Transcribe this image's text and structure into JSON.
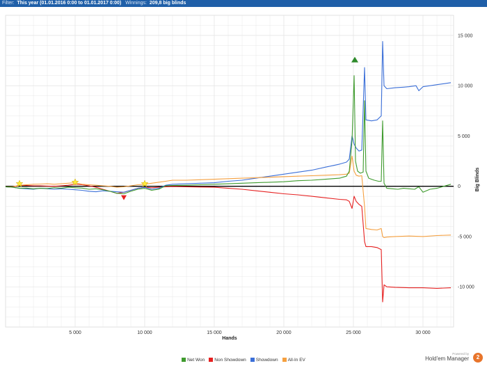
{
  "filter_bar": {
    "filter_label": "Filter:",
    "filter_value": "This year (01.01.2016 0:00 to 01.01.2017 0:00)",
    "winnings_label": "Winnings:",
    "winnings_value": "209,8 big blinds"
  },
  "branding": {
    "powered_by": "Powered by",
    "product": "Hold'em Manager",
    "logo_glyph": "2"
  },
  "colors": {
    "net_won": "#3f9b2e",
    "non_showdown": "#e62020",
    "showdown": "#3b6fd8",
    "all_in_ev": "#f5a040",
    "zero_line": "#000000",
    "grid": "#e2e2e2"
  },
  "chart_data": {
    "type": "line",
    "title": "",
    "xlabel": "Hands",
    "ylabel": "Big Blinds",
    "xlim": [
      0,
      32200
    ],
    "ylim": [
      -14000,
      17000
    ],
    "x_ticks": [
      {
        "value": 5000,
        "label": "5 000"
      },
      {
        "value": 10000,
        "label": "10 000"
      },
      {
        "value": 15000,
        "label": "15 000"
      },
      {
        "value": 20000,
        "label": "20 000"
      },
      {
        "value": 25000,
        "label": "25 000"
      },
      {
        "value": 30000,
        "label": "30 000"
      }
    ],
    "y_ticks": [
      {
        "value": 15000,
        "label": "15 000"
      },
      {
        "value": 10000,
        "label": "10 000"
      },
      {
        "value": 5000,
        "label": "5 000"
      },
      {
        "value": 0,
        "label": "0"
      },
      {
        "value": -5000,
        "label": "-5 000"
      },
      {
        "value": -10000,
        "label": "-10 000"
      }
    ],
    "legend_position": "bottom",
    "series": [
      {
        "name": "Net Won",
        "color": "#3f9b2e",
        "points": [
          [
            0,
            -50
          ],
          [
            500,
            -100
          ],
          [
            1000,
            -200
          ],
          [
            1500,
            -180
          ],
          [
            2000,
            -250
          ],
          [
            2500,
            -200
          ],
          [
            3000,
            -220
          ],
          [
            3500,
            -150
          ],
          [
            4000,
            -200
          ],
          [
            4500,
            -100
          ],
          [
            5000,
            -150
          ],
          [
            5500,
            -180
          ],
          [
            6000,
            -300
          ],
          [
            6500,
            -250
          ],
          [
            7000,
            -350
          ],
          [
            7500,
            -500
          ],
          [
            8000,
            -700
          ],
          [
            8500,
            -750
          ],
          [
            9000,
            -500
          ],
          [
            9500,
            -300
          ],
          [
            10000,
            -200
          ],
          [
            10500,
            -400
          ],
          [
            11000,
            -300
          ],
          [
            11500,
            50
          ],
          [
            12000,
            80
          ],
          [
            13000,
            100
          ],
          [
            14000,
            150
          ],
          [
            15000,
            200
          ],
          [
            16000,
            250
          ],
          [
            17000,
            300
          ],
          [
            18000,
            350
          ],
          [
            19000,
            400
          ],
          [
            20000,
            450
          ],
          [
            21000,
            550
          ],
          [
            22000,
            600
          ],
          [
            23000,
            700
          ],
          [
            24000,
            800
          ],
          [
            24500,
            1000
          ],
          [
            24700,
            1500
          ],
          [
            24900,
            4500
          ],
          [
            25050,
            11000
          ],
          [
            25150,
            2500
          ],
          [
            25300,
            1500
          ],
          [
            25500,
            1300
          ],
          [
            25700,
            1400
          ],
          [
            25800,
            8500
          ],
          [
            25900,
            1500
          ],
          [
            26100,
            800
          ],
          [
            26300,
            700
          ],
          [
            26500,
            600
          ],
          [
            26800,
            500
          ],
          [
            27000,
            500
          ],
          [
            27100,
            6500
          ],
          [
            27200,
            300
          ],
          [
            27400,
            -200
          ],
          [
            27800,
            -250
          ],
          [
            28200,
            -300
          ],
          [
            28600,
            -200
          ],
          [
            29000,
            -250
          ],
          [
            29400,
            -300
          ],
          [
            29700,
            -50
          ],
          [
            30000,
            -600
          ],
          [
            30500,
            -300
          ],
          [
            31000,
            -200
          ],
          [
            31500,
            0
          ],
          [
            32000,
            200
          ]
        ]
      },
      {
        "name": "Non Showdown",
        "color": "#e62020",
        "points": [
          [
            0,
            -50
          ],
          [
            500,
            -100
          ],
          [
            1000,
            100
          ],
          [
            1500,
            80
          ],
          [
            2000,
            50
          ],
          [
            2500,
            50
          ],
          [
            3000,
            20
          ],
          [
            3500,
            0
          ],
          [
            4000,
            50
          ],
          [
            4500,
            100
          ],
          [
            5000,
            200
          ],
          [
            5500,
            150
          ],
          [
            6000,
            50
          ],
          [
            6500,
            -100
          ],
          [
            7000,
            -300
          ],
          [
            7500,
            -500
          ],
          [
            8000,
            -700
          ],
          [
            8500,
            -600
          ],
          [
            9000,
            -400
          ],
          [
            9500,
            -200
          ],
          [
            10000,
            -100
          ],
          [
            10500,
            -150
          ],
          [
            11000,
            -100
          ],
          [
            11500,
            -50
          ],
          [
            12000,
            -30
          ],
          [
            13000,
            -50
          ],
          [
            14000,
            -80
          ],
          [
            15000,
            -100
          ],
          [
            16000,
            -200
          ],
          [
            17000,
            -300
          ],
          [
            18000,
            -450
          ],
          [
            19000,
            -600
          ],
          [
            20000,
            -750
          ],
          [
            21000,
            -850
          ],
          [
            22000,
            -1000
          ],
          [
            23000,
            -1150
          ],
          [
            24000,
            -1300
          ],
          [
            24500,
            -1350
          ],
          [
            24700,
            -1500
          ],
          [
            24900,
            -2200
          ],
          [
            25050,
            -1000
          ],
          [
            25200,
            -1500
          ],
          [
            25400,
            -1800
          ],
          [
            25600,
            -2000
          ],
          [
            25800,
            -5500
          ],
          [
            25900,
            -6000
          ],
          [
            26300,
            -6000
          ],
          [
            26700,
            -6100
          ],
          [
            27000,
            -6300
          ],
          [
            27100,
            -11500
          ],
          [
            27200,
            -9800
          ],
          [
            27400,
            -10000
          ],
          [
            28000,
            -10050
          ],
          [
            29000,
            -10100
          ],
          [
            30000,
            -10100
          ],
          [
            31000,
            -10150
          ],
          [
            32000,
            -10100
          ]
        ]
      },
      {
        "name": "Showdown",
        "color": "#3b6fd8",
        "points": [
          [
            0,
            -50
          ],
          [
            500,
            -100
          ],
          [
            1000,
            -200
          ],
          [
            1500,
            -250
          ],
          [
            2000,
            -300
          ],
          [
            2500,
            -200
          ],
          [
            3000,
            -250
          ],
          [
            3500,
            -300
          ],
          [
            4000,
            -250
          ],
          [
            4500,
            -300
          ],
          [
            5000,
            -350
          ],
          [
            5500,
            -400
          ],
          [
            6000,
            -500
          ],
          [
            6500,
            -550
          ],
          [
            7000,
            -450
          ],
          [
            7500,
            -500
          ],
          [
            8000,
            -550
          ],
          [
            8500,
            -600
          ],
          [
            9000,
            -400
          ],
          [
            9500,
            -200
          ],
          [
            10000,
            -100
          ],
          [
            10500,
            -300
          ],
          [
            11000,
            -200
          ],
          [
            11500,
            100
          ],
          [
            12000,
            200
          ],
          [
            13000,
            250
          ],
          [
            14000,
            300
          ],
          [
            15000,
            350
          ],
          [
            16000,
            500
          ],
          [
            17000,
            600
          ],
          [
            18000,
            800
          ],
          [
            19000,
            1000
          ],
          [
            20000,
            1200
          ],
          [
            21000,
            1400
          ],
          [
            22000,
            1600
          ],
          [
            23000,
            1900
          ],
          [
            24000,
            2200
          ],
          [
            24500,
            2400
          ],
          [
            24700,
            2700
          ],
          [
            24900,
            5000
          ],
          [
            25050,
            4200
          ],
          [
            25200,
            3800
          ],
          [
            25400,
            3500
          ],
          [
            25600,
            3600
          ],
          [
            25800,
            11800
          ],
          [
            25900,
            6600
          ],
          [
            26300,
            6500
          ],
          [
            26700,
            6600
          ],
          [
            27000,
            7000
          ],
          [
            27100,
            14400
          ],
          [
            27200,
            10000
          ],
          [
            27400,
            9700
          ],
          [
            28000,
            9800
          ],
          [
            28600,
            9850
          ],
          [
            29000,
            9900
          ],
          [
            29500,
            10000
          ],
          [
            29700,
            9500
          ],
          [
            30000,
            9900
          ],
          [
            30500,
            10000
          ],
          [
            31000,
            10100
          ],
          [
            31500,
            10200
          ],
          [
            32000,
            10300
          ]
        ]
      },
      {
        "name": "All-In EV",
        "color": "#f5a040",
        "points": [
          [
            0,
            -50
          ],
          [
            500,
            -50
          ],
          [
            1000,
            100
          ],
          [
            1500,
            150
          ],
          [
            2000,
            200
          ],
          [
            2500,
            220
          ],
          [
            3000,
            250
          ],
          [
            3500,
            200
          ],
          [
            4000,
            250
          ],
          [
            4500,
            300
          ],
          [
            5000,
            350
          ],
          [
            5500,
            200
          ],
          [
            6000,
            150
          ],
          [
            6500,
            100
          ],
          [
            7000,
            50
          ],
          [
            7500,
            0
          ],
          [
            8000,
            -100
          ],
          [
            8500,
            -50
          ],
          [
            9000,
            50
          ],
          [
            9500,
            150
          ],
          [
            10000,
            200
          ],
          [
            10500,
            300
          ],
          [
            11000,
            400
          ],
          [
            11500,
            500
          ],
          [
            12000,
            600
          ],
          [
            13000,
            600
          ],
          [
            14000,
            650
          ],
          [
            15000,
            700
          ],
          [
            16000,
            750
          ],
          [
            17000,
            800
          ],
          [
            18000,
            850
          ],
          [
            19000,
            900
          ],
          [
            20000,
            950
          ],
          [
            21000,
            1000
          ],
          [
            22000,
            1050
          ],
          [
            23000,
            1100
          ],
          [
            24000,
            1150
          ],
          [
            24500,
            1200
          ],
          [
            24700,
            1300
          ],
          [
            24900,
            3000
          ],
          [
            25050,
            1500
          ],
          [
            25200,
            1100
          ],
          [
            25400,
            1000
          ],
          [
            25600,
            1050
          ],
          [
            25800,
            -2000
          ],
          [
            25900,
            -4200
          ],
          [
            26300,
            -4300
          ],
          [
            26700,
            -4350
          ],
          [
            27000,
            -4200
          ],
          [
            27100,
            -5000
          ],
          [
            27200,
            -5100
          ],
          [
            27400,
            -5050
          ],
          [
            28000,
            -5000
          ],
          [
            29000,
            -4950
          ],
          [
            30000,
            -5000
          ],
          [
            31000,
            -4900
          ],
          [
            32000,
            -4850
          ]
        ]
      }
    ],
    "markers": [
      {
        "type": "star",
        "x": 1000,
        "y": 250,
        "color": "#ffeb3b"
      },
      {
        "type": "star",
        "x": 5000,
        "y": 400,
        "color": "#ffeb3b"
      },
      {
        "type": "star",
        "x": 10000,
        "y": 250,
        "color": "#ffeb3b"
      },
      {
        "type": "triangle-down",
        "x": 8500,
        "y": -1100,
        "color": "#e62020"
      },
      {
        "type": "triangle-up",
        "x": 25100,
        "y": 12600,
        "color": "#2d8a2a"
      }
    ]
  }
}
